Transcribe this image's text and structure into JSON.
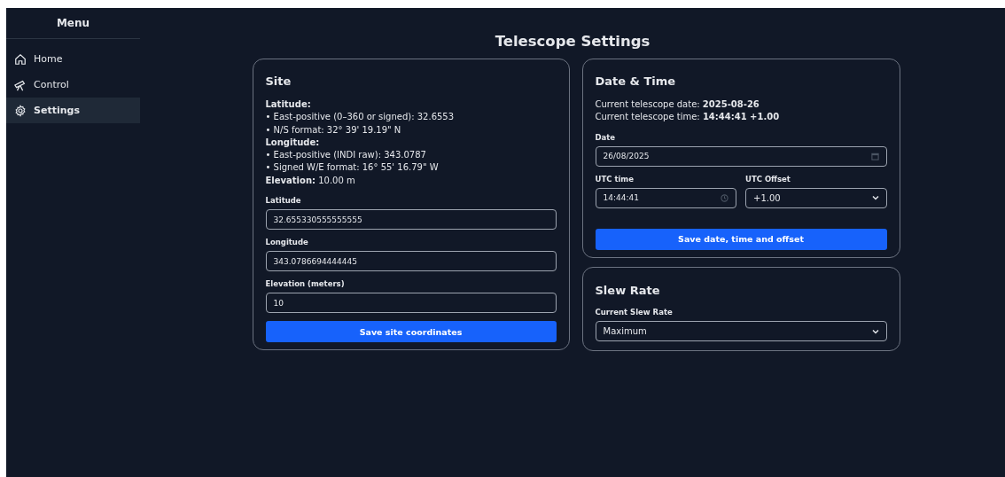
{
  "sidebar": {
    "title": "Menu",
    "items": [
      {
        "label": "Home",
        "kind": "home",
        "selected": false
      },
      {
        "label": "Control",
        "kind": "telescope",
        "selected": false
      },
      {
        "label": "Settings",
        "kind": "gear",
        "selected": true
      }
    ]
  },
  "page_title": "Telescope Settings",
  "site": {
    "title": "Site",
    "info": [
      {
        "kind": "heading",
        "text": "Latitude:"
      },
      {
        "kind": "line",
        "text": "• East-positive (0–360 or signed): 32.6553"
      },
      {
        "kind": "line",
        "text": "• N/S format: 32° 39' 19.19\" N"
      },
      {
        "kind": "heading",
        "text": "Longitude:"
      },
      {
        "kind": "line",
        "text": "• East-positive (INDI raw): 343.0787"
      },
      {
        "kind": "line",
        "text": "• Signed W/E format: 16° 55' 16.79\" W"
      },
      {
        "kind": "line",
        "text": "**Elevation:** 10.00 m"
      }
    ],
    "fields": [
      {
        "label": "Latitude",
        "value": "32.655330555555555"
      },
      {
        "label": "Longitude",
        "value": "343.0786694444445"
      },
      {
        "label": "Elevation (meters)",
        "value": "10"
      }
    ],
    "button": "Save site coordinates"
  },
  "date_time": {
    "title": "Date & Time",
    "info": [
      {
        "kind": "line",
        "text": "Current telescope date: **2025-08-26**"
      },
      {
        "kind": "line",
        "text": "Current telescope time: **14:44:41 +1.00**"
      }
    ],
    "date": {
      "label": "Date",
      "value": "26/08/2025"
    },
    "utc_time": {
      "label": "UTC time",
      "value": "14:44:41"
    },
    "utc_offset": {
      "label": "UTC Offset",
      "value": "+1.00"
    },
    "button": "Save date, time and offset"
  },
  "slew_rate": {
    "title": "Slew Rate",
    "field": {
      "label": "Current Slew Rate",
      "value": "Maximum"
    }
  }
}
